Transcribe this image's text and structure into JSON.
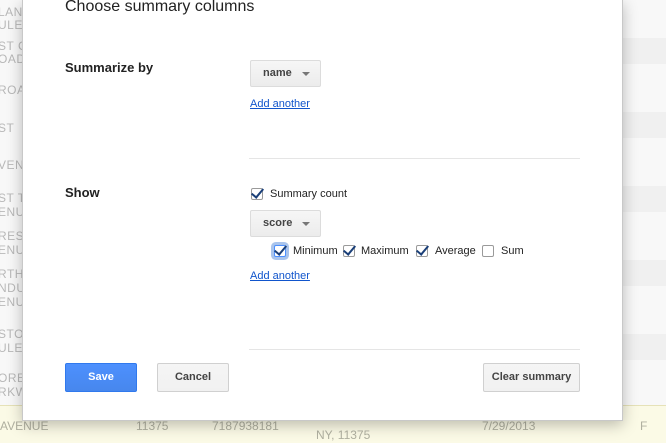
{
  "background": {
    "left_cells": [
      "LANE",
      "ULE",
      "ST C",
      "OAD",
      "ROAD",
      "ST",
      "VENU",
      "ST T",
      "ENU",
      "RES",
      "ENU",
      "RTH",
      "NDU",
      "ENU",
      "STOR",
      "ULE",
      "ORE",
      "RKW"
    ],
    "bottom_row": [
      "AVENUE",
      "11375",
      "7187938181",
      "NY, 11375",
      "7/29/2013",
      "F"
    ]
  },
  "dialog": {
    "title": "Choose summary columns",
    "summarize_by": {
      "label": "Summarize by",
      "dropdown": "name",
      "add_another": "Add another"
    },
    "show": {
      "label": "Show",
      "summary_count": {
        "label": "Summary count",
        "checked": true
      },
      "dropdown": "score",
      "options": [
        {
          "label": "Minimum",
          "checked": true
        },
        {
          "label": "Maximum",
          "checked": true
        },
        {
          "label": "Average",
          "checked": true
        },
        {
          "label": "Sum",
          "checked": false
        }
      ],
      "add_another": "Add another"
    },
    "buttons": {
      "save": "Save",
      "cancel": "Cancel",
      "clear_summary": "Clear summary"
    }
  }
}
